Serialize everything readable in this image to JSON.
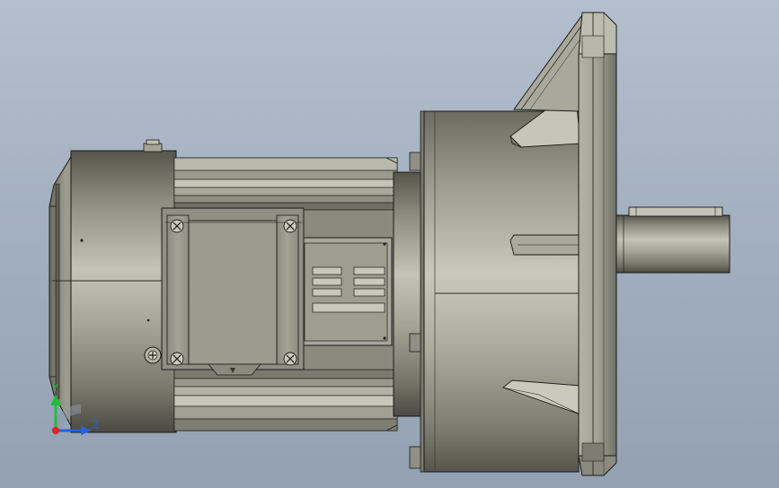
{
  "viewport": {
    "background_top": "#b4bfcd",
    "background_bottom": "#93a1b3"
  },
  "model": {
    "name": "gear-motor-assembly",
    "body_color": "#9c9c8e",
    "highlight_color": "#d0d0c4",
    "shadow_color": "#4a4a42",
    "edge_color": "#1a1a1a"
  },
  "triad": {
    "y_label": "Y",
    "z_label": "Z",
    "y_color": "#1dbf3a",
    "z_color": "#2a5fe0",
    "origin_color": "#e02020"
  }
}
